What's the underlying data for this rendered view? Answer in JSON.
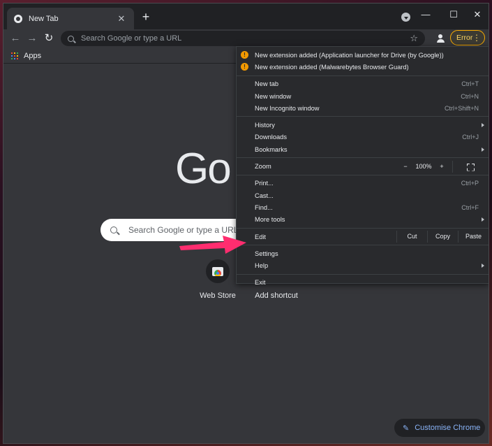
{
  "tab": {
    "title": "New Tab",
    "close": "✕",
    "new": "+"
  },
  "window": {
    "minimize": "—",
    "maximize": "☐",
    "close": "✕"
  },
  "toolbar": {
    "back": "←",
    "forward": "→",
    "reload": "↻",
    "omnibox_placeholder": "Search Google or type a URL",
    "star": "☆",
    "error_label": "Error",
    "kebab": "⋮"
  },
  "bookmarks": {
    "apps_label": "Apps"
  },
  "colors": {
    "apps_grid": [
      "#ea4335",
      "#fbbc04",
      "#34a853",
      "#4285f4",
      "#ea4335",
      "#fbbc04",
      "#34a853",
      "#4285f4",
      "#ea4335"
    ],
    "accent": "#8ab4f8",
    "warning": "#f29900",
    "arrow": "#ff2d6f"
  },
  "ntp": {
    "logo_text": "Go",
    "search_placeholder": "Search Google or type a URL",
    "shortcuts": [
      {
        "label": "Web Store",
        "icon": "webstore-icon"
      },
      {
        "label": "Add shortcut",
        "icon": "add-icon"
      }
    ],
    "customise_label": "Customise Chrome",
    "pencil": "✎"
  },
  "menu": {
    "notices": [
      "New extension added (Application launcher for Drive (by Google))",
      "New extension added (Malwarebytes Browser Guard)"
    ],
    "group1": [
      {
        "label": "New tab",
        "shortcut": "Ctrl+T"
      },
      {
        "label": "New window",
        "shortcut": "Ctrl+N"
      },
      {
        "label": "New Incognito window",
        "shortcut": "Ctrl+Shift+N"
      }
    ],
    "group2": [
      {
        "label": "History",
        "submenu": true
      },
      {
        "label": "Downloads",
        "shortcut": "Ctrl+J"
      },
      {
        "label": "Bookmarks",
        "submenu": true
      }
    ],
    "zoom": {
      "label": "Zoom",
      "minus": "−",
      "level": "100%",
      "plus": "+"
    },
    "group3": [
      {
        "label": "Print...",
        "shortcut": "Ctrl+P"
      },
      {
        "label": "Cast..."
      },
      {
        "label": "Find...",
        "shortcut": "Ctrl+F"
      },
      {
        "label": "More tools",
        "submenu": true
      }
    ],
    "edit": {
      "label": "Edit",
      "cut": "Cut",
      "copy": "Copy",
      "paste": "Paste"
    },
    "settings": "Settings",
    "help": "Help",
    "exit": "Exit"
  }
}
